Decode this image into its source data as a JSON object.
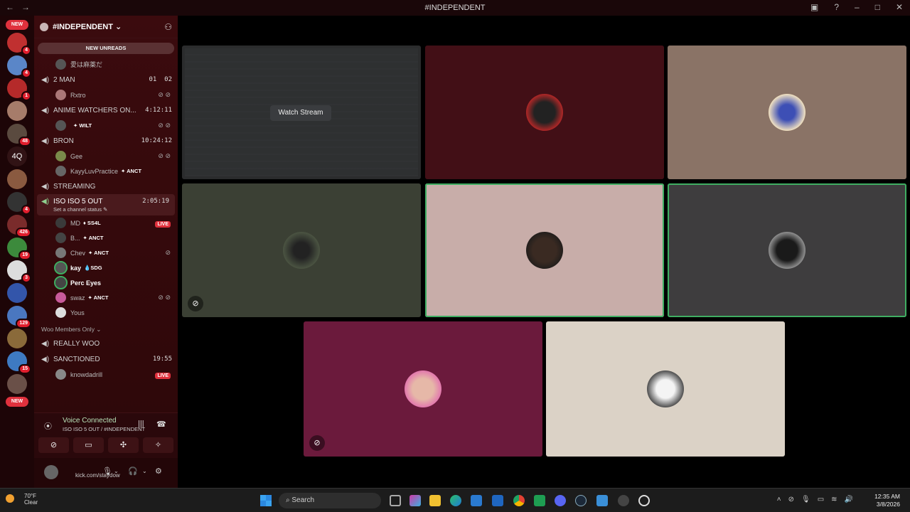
{
  "window": {
    "title": "#INDEPENDENT",
    "back": "←",
    "forward": "→"
  },
  "servers": {
    "new_top": "NEW",
    "new_bottom": "NEW",
    "text_server": "4Q",
    "badges": [
      "4",
      "4",
      "1",
      "48",
      "4",
      "426",
      "19",
      "3",
      "129",
      "15"
    ]
  },
  "guild": {
    "name": "#INDEPENDENT ⌄",
    "new_unreads": "NEW UNREADS"
  },
  "channels": {
    "c0": {
      "name": "愛は麻薬だ"
    },
    "c1": {
      "name": "2 MAN",
      "a": "01",
      "b": "02"
    },
    "c1_users": [
      {
        "name": "Rxtro"
      }
    ],
    "c2": {
      "name": "ANIME WATCHERS ON...",
      "timer": "4:12:11"
    },
    "c2_users": [
      {
        "name": "",
        "tag": "✦ WILT"
      }
    ],
    "c3": {
      "name": "BRON",
      "timer": "10:24:12"
    },
    "c3_users": [
      {
        "name": "Gee"
      },
      {
        "name": "KayyLuvPractice",
        "tag": "ANCT"
      }
    ],
    "c4": {
      "name": "STREAMING"
    },
    "c5": {
      "name": "ISO ISO 5 OUT",
      "timer": "2:05:19",
      "status": "Set a channel status"
    },
    "c5_users": [
      {
        "name": "MD",
        "tag": "SS4L",
        "live": "LIVE"
      },
      {
        "name": "B...",
        "tag": "ANCT"
      },
      {
        "name": "Chev",
        "tag": "ANCT"
      },
      {
        "name": "kay",
        "tag": "SDG"
      },
      {
        "name": "Perc Eyes"
      },
      {
        "name": "swaz",
        "tag": "ANCT"
      },
      {
        "name": "Yous"
      }
    ],
    "category": "Woo Members Only ⌄",
    "c6": {
      "name": "REALLY WOO"
    },
    "c7": {
      "name": "SANCTIONED",
      "timer": "19:55"
    },
    "c7_users": [
      {
        "name": "knowdadrill",
        "live": "LIVE"
      }
    ]
  },
  "voice": {
    "title": "Voice Connected",
    "sub": "ISO ISO 5 OUT / #INDEPENDENT"
  },
  "userpanel": {
    "status": "kick.com/staydow"
  },
  "stage": {
    "watch": "Watch Stream"
  },
  "colors": {
    "speaking": "#3fae62",
    "live": "#e0313d",
    "accent_bg": "#3b0b0e"
  },
  "taskbar": {
    "temp": "70°F",
    "weather": "Clear",
    "search": "Search",
    "time": "12:35 AM",
    "date": "3/8/2026"
  }
}
